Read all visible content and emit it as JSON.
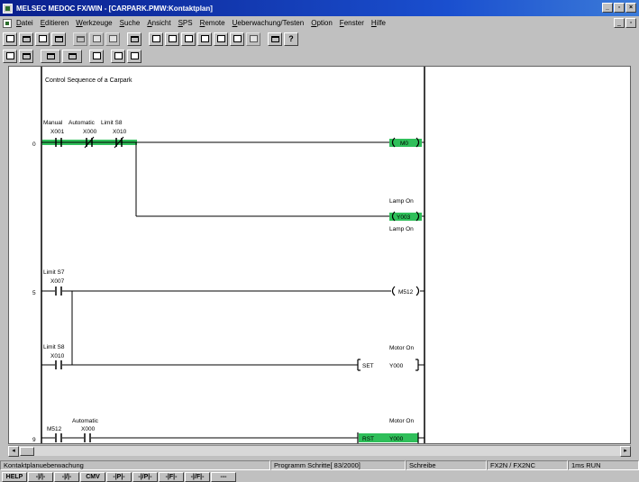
{
  "window": {
    "title": "MELSEC MEDOC FX/WIN - [CARPARK.PMW:Kontaktplan]",
    "min_icon": "minimize-icon",
    "max_icon": "restore-icon",
    "close_icon": "close-icon"
  },
  "menu": {
    "items": [
      "Datei",
      "Editieren",
      "Werkzeuge",
      "Suche",
      "Ansicht",
      "SPS",
      "Remote",
      "Ueberwachung/Testen",
      "Option",
      "Fenster",
      "Hilfe"
    ]
  },
  "toolbar": {
    "row1_icons": [
      "new-icon",
      "open-icon",
      "save-icon",
      "print-icon",
      "cut-icon",
      "copy-icon",
      "paste-icon",
      "find-icon",
      "read-plc-icon",
      "write-plc-icon",
      "ladder-view-icon",
      "list-view-icon",
      "monitor-icon",
      "device-test-icon",
      "register-icon",
      "help-icon"
    ],
    "row2_icons": [
      "ladder-mode-icon",
      "instruction-mode-icon",
      "comment-icon",
      "coil-comment-icon",
      "statement-icon",
      "note-icon"
    ]
  },
  "ladder": {
    "header_comment": "Control Sequence of a Carpark",
    "rungs": [
      {
        "step": "0",
        "contacts": [
          {
            "comment": "Manual",
            "device": "X001",
            "type": "NO"
          },
          {
            "comment": "Automatic",
            "device": "X000",
            "type": "NC"
          },
          {
            "comment": "Limit S8",
            "device": "X010",
            "type": "NC"
          }
        ],
        "outputs": [
          {
            "device": "M0",
            "comment_top": "",
            "comment_bottom": ""
          },
          {
            "device": "Y003",
            "comment_top": "Lamp On",
            "comment_bottom": "Lamp On"
          }
        ]
      },
      {
        "step": "5",
        "contacts": [
          {
            "comment": "Limit S7",
            "device": "X007",
            "type": "NO"
          },
          {
            "comment": "Limit S8",
            "device": "X010",
            "type": "NO"
          }
        ],
        "outputs": [
          {
            "device": "M512",
            "instr": ""
          },
          {
            "device": "Y000",
            "instr": "SET",
            "comment_top": "Motor On"
          }
        ]
      },
      {
        "step": "9",
        "contacts": [
          {
            "comment": "",
            "device": "M512",
            "type": "NO"
          },
          {
            "comment": "Automatic",
            "device": "X000",
            "type": "NO"
          }
        ],
        "outputs": [
          {
            "device": "Y000",
            "instr": "RST",
            "comment_top": "Motor On"
          }
        ]
      }
    ]
  },
  "statusbar": {
    "mode": "Kontaktplanueberwachung",
    "program_steps": "Programm Schritte[ 83/2000]",
    "write_mode": "Schreibe",
    "plc_type": "FX2N / FX2NC",
    "run_state": "1ms RUN"
  },
  "function_keys": [
    "HELP",
    "-|/|-",
    "-|/|-",
    "CMV",
    "-|P|-",
    "-|/P|-",
    "-|F|-",
    "-|/F|-",
    "---"
  ],
  "colors": {
    "title_bar": "#0a1f8c",
    "monitor_active": "#2fbf5a",
    "background": "#c0c0c0"
  }
}
